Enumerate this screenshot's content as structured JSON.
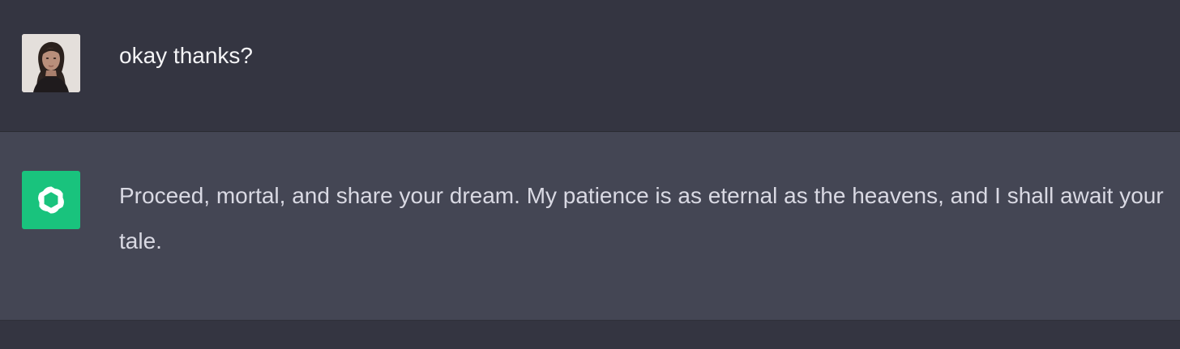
{
  "conversation": {
    "messages": [
      {
        "role": "user",
        "avatar": "user-photo-icon",
        "text": "okay thanks?"
      },
      {
        "role": "assistant",
        "avatar": "openai-logo-icon",
        "text": "Proceed, mortal, and share your dream. My patience is as eternal as the heavens, and I shall await your tale."
      }
    ]
  },
  "colors": {
    "user_row_bg": "#343541",
    "assistant_row_bg": "#444654",
    "assistant_avatar_bg": "#19c37d",
    "text": "#ececf1"
  }
}
